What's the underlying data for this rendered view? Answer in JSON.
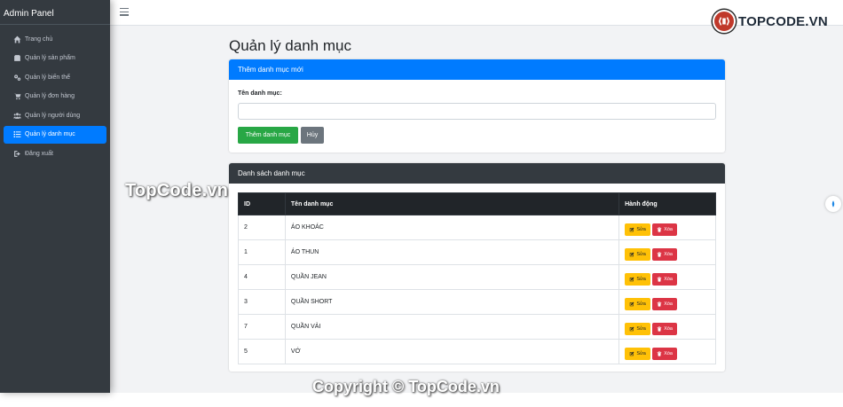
{
  "sidebar": {
    "brand": "Admin Panel",
    "items": [
      {
        "label": "Trang chủ",
        "icon": "home-icon",
        "active": false
      },
      {
        "label": "Quản lý sản phẩm",
        "icon": "box-icon",
        "active": false
      },
      {
        "label": "Quản lý biến thể",
        "icon": "cogs-icon",
        "active": false
      },
      {
        "label": "Quản lý đơn hàng",
        "icon": "cart-icon",
        "active": false
      },
      {
        "label": "Quản lý người dùng",
        "icon": "users-icon",
        "active": false
      },
      {
        "label": "Quản lý danh mục",
        "icon": "list-icon",
        "active": true
      },
      {
        "label": "Đăng xuất",
        "icon": "logout-icon",
        "active": false
      }
    ]
  },
  "topbar": {
    "logo_text": "TOPCODE.VN"
  },
  "page": {
    "title": "Quản lý danh mục"
  },
  "form": {
    "header": "Thêm danh mục mới",
    "label": "Tên danh mục:",
    "input_value": "",
    "add_button": "Thêm danh mục",
    "cancel_button": "Hủy"
  },
  "list": {
    "header": "Danh sách danh mục",
    "columns": [
      "ID",
      "Tên danh mục",
      "Hành động"
    ],
    "rows": [
      {
        "id": "2",
        "name": "ÁO KHOÁC"
      },
      {
        "id": "1",
        "name": "ÁO THUN"
      },
      {
        "id": "4",
        "name": "QUẦN JEAN"
      },
      {
        "id": "3",
        "name": "QUẦN SHORT"
      },
      {
        "id": "7",
        "name": "QUẦN VẢI"
      },
      {
        "id": "5",
        "name": "VỚ"
      }
    ],
    "edit_label": "Sửa",
    "delete_label": "Xóa"
  },
  "watermarks": {
    "middle": "TopCode.vn",
    "bottom": "Copyright © TopCode.vn"
  },
  "colors": {
    "primary": "#007bff",
    "success": "#28a745",
    "warning": "#ffc107",
    "danger": "#dc3545",
    "dark": "#343a40"
  }
}
